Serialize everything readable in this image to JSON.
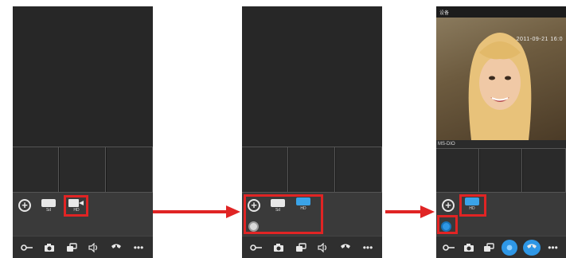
{
  "screens": [
    {
      "controls": {
        "sd_label": "Sd",
        "hd_label": "HD"
      }
    },
    {
      "controls": {
        "sd_label": "Sd",
        "hd_label": "HD"
      }
    },
    {
      "status": "设备",
      "timestamp": "2011-09-21 16:0",
      "camera_label": "MS-DIO",
      "controls": {
        "hd_label": "HD"
      }
    }
  ],
  "icons": {
    "add": "add-circle-icon",
    "key": "key-icon",
    "camera": "camera-icon",
    "record": "record-icon",
    "speaker": "speaker-icon",
    "call": "call-icon",
    "more": "more-icon"
  },
  "colors": {
    "highlight": "#e02424",
    "accent_blue": "#2e97e6",
    "panel": "#3a3a3a",
    "background": "#2b2b2b"
  }
}
